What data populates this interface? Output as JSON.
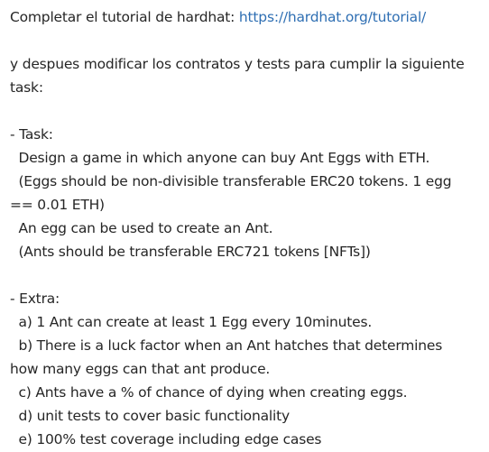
{
  "intro": {
    "text": "Completar el tutorial de hardhat: ",
    "link": "https://hardhat.org/tutorial/"
  },
  "instruction": {
    "line1": "y despues modificar los contratos y tests para cumplir la siguiente",
    "line2": "task:"
  },
  "task": {
    "heading": "- Task:",
    "lines": [
      "  Design a game in which anyone can buy Ant Eggs with ETH.",
      "  (Eggs should be non-divisible transferable ERC20 tokens. 1 egg",
      "== 0.01 ETH)",
      "  An egg can be used to create an Ant.",
      "  (Ants should be transferable ERC721 tokens [NFTs])"
    ]
  },
  "extra": {
    "heading": "- Extra:",
    "lines": [
      "  a) 1 Ant can create at least 1 Egg every 10minutes.",
      "  b) There is a luck factor when an Ant hatches that determines",
      "how many eggs can that ant produce.",
      "  c) Ants have a % of chance of dying when creating eggs.",
      "  d) unit tests to cover basic functionality",
      "  e) 100% test coverage including edge cases"
    ]
  }
}
